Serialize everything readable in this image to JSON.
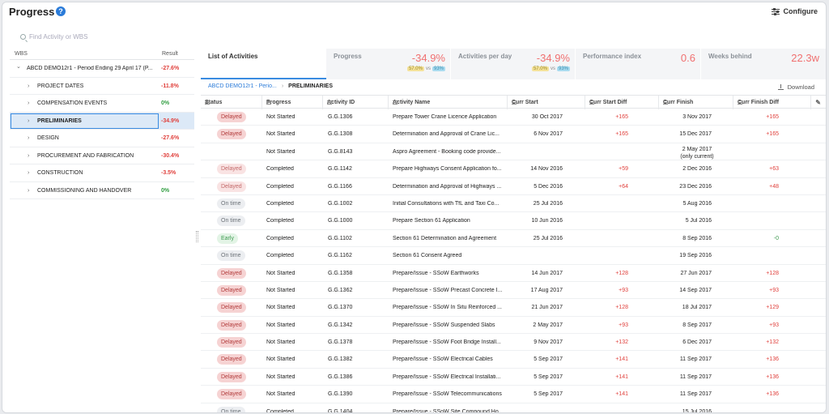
{
  "header": {
    "title": "Progress",
    "help_icon": "?",
    "configure_label": "Configure"
  },
  "search": {
    "placeholder": "Find Activity or WBS"
  },
  "wbs": {
    "col_wbs": "WBS",
    "col_result": "Result",
    "items": [
      {
        "label": "ABCD DEMO12r1 - Period Ending 29 April 17 (P...",
        "result": "-27.6%",
        "expanded": true,
        "level": 0
      },
      {
        "label": "PROJECT DATES",
        "result": "-11.8%",
        "level": 1
      },
      {
        "label": "COMPENSATION EVENTS",
        "result": "0%",
        "level": 1
      },
      {
        "label": "PRELIMINARIES",
        "result": "-34.9%",
        "level": 1,
        "selected": true
      },
      {
        "label": "DESIGN",
        "result": "-27.6%",
        "level": 1
      },
      {
        "label": "PROCUREMENT AND FABRICATION",
        "result": "-30.4%",
        "level": 1
      },
      {
        "label": "CONSTRUCTION",
        "result": "-3.5%",
        "level": 1
      },
      {
        "label": "COMMISSIONING AND HANDOVER",
        "result": "0%",
        "level": 1
      }
    ]
  },
  "metrics": {
    "tab_label": "List of Activities",
    "progress": {
      "label": "Progress",
      "value": "-34.9%",
      "chip1": "57.0%",
      "vs": "vs",
      "chip2": "93%"
    },
    "activities_per_day": {
      "label": "Activities per day",
      "value": "-34.9%",
      "chip1": "57.0%",
      "vs": "vs",
      "chip2": "93%"
    },
    "performance_index": {
      "label": "Performance index",
      "value": "0.6"
    },
    "weeks_behind": {
      "label": "Weeks behind",
      "value": "22.3w"
    }
  },
  "breadcrumb": {
    "root": "ABCD DEMO12r1 - Perio...",
    "separator": "›",
    "current": "PRELIMINARIES"
  },
  "download_label": "Download",
  "table": {
    "columns": [
      "Status",
      "Progress",
      "Activity ID",
      "Activity Name",
      "Curr Start",
      "Curr Start Diff",
      "Curr Finish",
      "Curr Finish Diff"
    ],
    "rows": [
      {
        "status": "Delayed",
        "progress": "Not Started",
        "id": "G.G.1306",
        "name": "Prepare Tower Crane Licence Application",
        "start": "30 Oct 2017",
        "start_diff": "+165",
        "finish": "3 Nov 2017",
        "finish_diff": "+165"
      },
      {
        "status": "Delayed",
        "progress": "Not Started",
        "id": "G.G.1308",
        "name": "Determination and Approval of Crane Lic...",
        "start": "6 Nov 2017",
        "start_diff": "+165",
        "finish": "15 Dec 2017",
        "finish_diff": "+165"
      },
      {
        "status": "",
        "progress": "Not Started",
        "id": "G.G.8143",
        "name": "Aspro Agreement - Booking code provide...",
        "start": "",
        "start_diff": "",
        "finish": "2 May 2017",
        "finish_note": "(only current)",
        "finish_diff": ""
      },
      {
        "status": "Delayed",
        "progress": "Completed",
        "id": "G.G.1142",
        "name": "Prepare Highways Consent Application fo...",
        "start": "14 Nov 2016",
        "start_diff": "+59",
        "finish": "2 Dec 2016",
        "finish_diff": "+63"
      },
      {
        "status": "Delayed",
        "progress": "Completed",
        "id": "G.G.1166",
        "name": "Determination and Approval of Highways ...",
        "start": "5 Dec 2016",
        "start_diff": "+64",
        "finish": "23 Dec 2016",
        "finish_diff": "+48"
      },
      {
        "status": "On time",
        "progress": "Completed",
        "id": "G.G.1002",
        "name": "Initial Consultations with TfL and Taxi Co...",
        "start": "25 Jul 2016",
        "start_diff": "",
        "finish": "5 Aug 2016",
        "finish_diff": ""
      },
      {
        "status": "On time",
        "progress": "Completed",
        "id": "G.G.1000",
        "name": "Prepare Section 61 Application",
        "start": "10 Jun 2016",
        "start_diff": "",
        "finish": "5 Jul 2016",
        "finish_diff": ""
      },
      {
        "status": "Early",
        "progress": "Completed",
        "id": "G.G.1102",
        "name": "Section 61 Determination and Agreement",
        "start": "25 Jul 2016",
        "start_diff": "",
        "finish": "8 Sep 2016",
        "finish_diff": "-0"
      },
      {
        "status": "On time",
        "progress": "Completed",
        "id": "G.G.1162",
        "name": "Section 61 Consent Agreed",
        "start": "",
        "start_diff": "",
        "finish": "19 Sep 2016",
        "finish_diff": ""
      },
      {
        "status": "Delayed",
        "progress": "Not Started",
        "id": "G.G.1358",
        "name": "Prepare/Issue - SSoW Earthworks",
        "start": "14 Jun 2017",
        "start_diff": "+128",
        "finish": "27 Jun 2017",
        "finish_diff": "+128"
      },
      {
        "status": "Delayed",
        "progress": "Not Started",
        "id": "G.G.1362",
        "name": "Prepare/Issue - SSoW Precast Concrete I...",
        "start": "17 Aug 2017",
        "start_diff": "+93",
        "finish": "14 Sep 2017",
        "finish_diff": "+93"
      },
      {
        "status": "Delayed",
        "progress": "Not Started",
        "id": "G.G.1370",
        "name": "Prepare/Issue - SSoW In Situ Reinforced ...",
        "start": "21 Jun 2017",
        "start_diff": "+128",
        "finish": "18 Jul 2017",
        "finish_diff": "+129"
      },
      {
        "status": "Delayed",
        "progress": "Not Started",
        "id": "G.G.1342",
        "name": "Prepare/Issue - SSoW Suspended Slabs",
        "start": "2 May 2017",
        "start_diff": "+93",
        "finish": "8 Sep 2017",
        "finish_diff": "+93"
      },
      {
        "status": "Delayed",
        "progress": "Not Started",
        "id": "G.G.1378",
        "name": "Prepare/Issue - SSoW Foot Bridge Install...",
        "start": "9 Nov 2017",
        "start_diff": "+132",
        "finish": "6 Dec 2017",
        "finish_diff": "+132"
      },
      {
        "status": "Delayed",
        "progress": "Not Started",
        "id": "G.G.1382",
        "name": "Prepare/Issue - SSoW Electrical Cables",
        "start": "5 Sep 2017",
        "start_diff": "+141",
        "finish": "11 Sep 2017",
        "finish_diff": "+136"
      },
      {
        "status": "Delayed",
        "progress": "Not Started",
        "id": "G.G.1386",
        "name": "Prepare/Issue - SSoW Electrical Installati...",
        "start": "5 Sep 2017",
        "start_diff": "+141",
        "finish": "11 Sep 2017",
        "finish_diff": "+136"
      },
      {
        "status": "Delayed",
        "progress": "Not Started",
        "id": "G.G.1390",
        "name": "Prepare/Issue - SSoW Telecommunications",
        "start": "5 Sep 2017",
        "start_diff": "+141",
        "finish": "11 Sep 2017",
        "finish_diff": "+136"
      },
      {
        "status": "On time",
        "progress": "Completed",
        "id": "G.G.1404",
        "name": "Prepare/Issue - SSoW Site Compound Ho...",
        "start": "",
        "start_diff": "",
        "finish": "15 Jul 2016",
        "finish_diff": ""
      }
    ]
  }
}
